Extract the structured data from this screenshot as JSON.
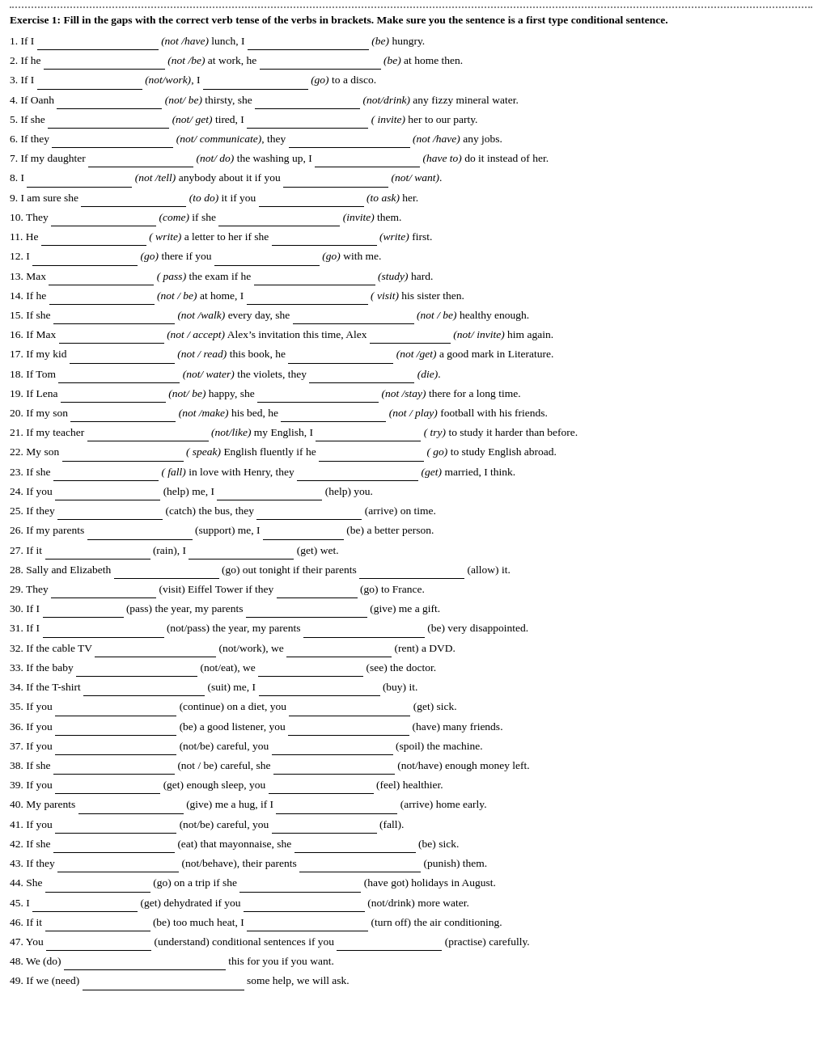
{
  "title": "Exercise 1: Fill in the gaps with the correct verb tense of the verbs in brackets. Make sure you the sentence is a first type conditional sentence.",
  "sentences": [
    "1. If I __________________ <em>(not /have)</em> lunch, I __________________ <em>(be)</em> hungry.",
    "2. If he __________________ <em>(not /be)</em> at work, he __________________ <em>(be)</em> at home then.",
    "3. If I ________________ <em>(not/work)</em>, I ________________ <em>(go)</em> to a disco.",
    "4. If Oanh ________________ <em>(not/ be)</em> thirsty, she ________________ <em>(not/drink)</em> any fizzy mineral water.",
    "5. If she __________________ <em>(not/ get)</em> tired, I __________________ <em>(invite)</em> her to our party.",
    "6. If they __________________ <em>(not/ communicate)</em>, they __________________ <em>(not /have)</em> any jobs.",
    "7. If my daughter ________________ <em>(not/ do)</em> the washing up, I ________________ <em>(have to)</em> do it instead of her.",
    "8. I ________________ <em>(not /tell)</em> anybody about it if you ________________ <em>(not/ want)</em>.",
    "9. I am sure she ________________ <em>(to do)</em> it if you ________________ <em>(to ask)</em> her.",
    "10. They ________________ <em>(come)</em> if she __________________ <em>(invite)</em> them.",
    "11. He ________________ <em>( write)</em> a letter to her if she ________________ <em>(write)</em> first.",
    "12. I ________________ <em>(go)</em> there if you ________________ <em>(go)</em> with me.",
    "13. Max ________________ <em>( pass)</em> the exam if he __________________ <em>(study)</em> hard.",
    "14. If he ________________ <em>(not / be)</em> at home, I __________________ <em>( visit)</em> his sister then.",
    "15. If she __________________ <em>(not /walk)</em> every day, she __________________ <em>(not / be)</em> healthy enough.",
    "16. If Max ________________ <em>(not / accept)</em> Alex’s invitation this time, Alex ________ <em>(not/ invite)</em> him again.",
    "17. If my kid ________________ <em>(not / read)</em> this book, he ________________ <em>(not /get)</em> a good mark in Literature.",
    "18. If Tom __________________ <em>(not/ water)</em> the violets, they ________________ <em>(die)</em>.",
    "19. If Lena ________________ <em>(not/ be)</em> happy, she __________________ <em>(not /stay)</em> there for a long time.",
    "20. If my son ________________ <em>(not /make)</em> his bed, he ________________ <em>(not / play)</em> football with his friends.",
    "21. If my teacher ________________ <em>(not/like)</em> my English, I ________________ <em>( try)</em> to study it harder than before.",
    "22. My son __________________ <em>( speak)</em> English fluently if he ________________ <em>( go)</em> to study English abroad.",
    "23. If she ________________ <em>( fall)</em> in love with Henry, they __________________ <em>(get)</em> married, I think.",
    "24. If you ________________ (help) me, I ________________ (help) you.",
    "25. If they ________________ (catch) the bus, they ________________ (arrive) on time.",
    "26. If my parents ________________ (support) me, I ________________ (be) a better person.",
    "27. If it ________________ (rain), I ________________ (get) wet.",
    "28. Sally and Elizabeth ________________ (go) out tonight if their parents ________________ (allow) it.",
    "29. They ________________ (visit) Eiffel Tower if they ________________ (go) to France.",
    "30. If I ________________ (pass) the year, my parents __________________ (give) me a gift.",
    "31. If I __________________ (not/pass) the year, my parents __________________ (be) very disappointed.",
    "32. If the cable TV __________________ (not/work), we ________________ (rent) a DVD.",
    "33. If the baby __________________ (not/eat), we ________________ (see) the doctor.",
    "34. If the T-shirt __________________ (suit) me, I __________________ (buy) it.",
    "35. If you __________________ (continue) on a diet, you __________________ (get) sick.",
    "36. If you __________________ (be) a good listener, you __________________ (have) many friends.",
    "37. If you __________________ (not/be) careful, you __________________ (spoil) the machine.",
    "38. If she __________________ (not / be) careful, she __________________ (not/have) enough money left.",
    "39. If you ________________ (get) enough sleep, you ________________ (feel) healthier.",
    "40. My parents ________________ (give) me a hug, if I __________________ (arrive) home early.",
    "41. If you __________________ (not/be) careful, you ________________ (fall).",
    "42. If she __________________ (eat) that mayonnaise, she __________________ (be) sick.",
    "43. If they __________________ (not/behave), their parents __________________ (punish) them.",
    "44. She ________________ (go) on a trip if she __________________ (have got) holidays in August.",
    "45. I ________________ (get) dehydrated if you __________________ (not/drink) more water.",
    "46. If it ________________ (be) too much heat, I __________________ (turn off) the air conditioning.",
    "47. You ________________ (understand) conditional sentences if you ________________ (practise) carefully.",
    "48. We (do) __________________________ this for you if you want.",
    "49. If we (need) __________________________ some help, we will ask."
  ]
}
